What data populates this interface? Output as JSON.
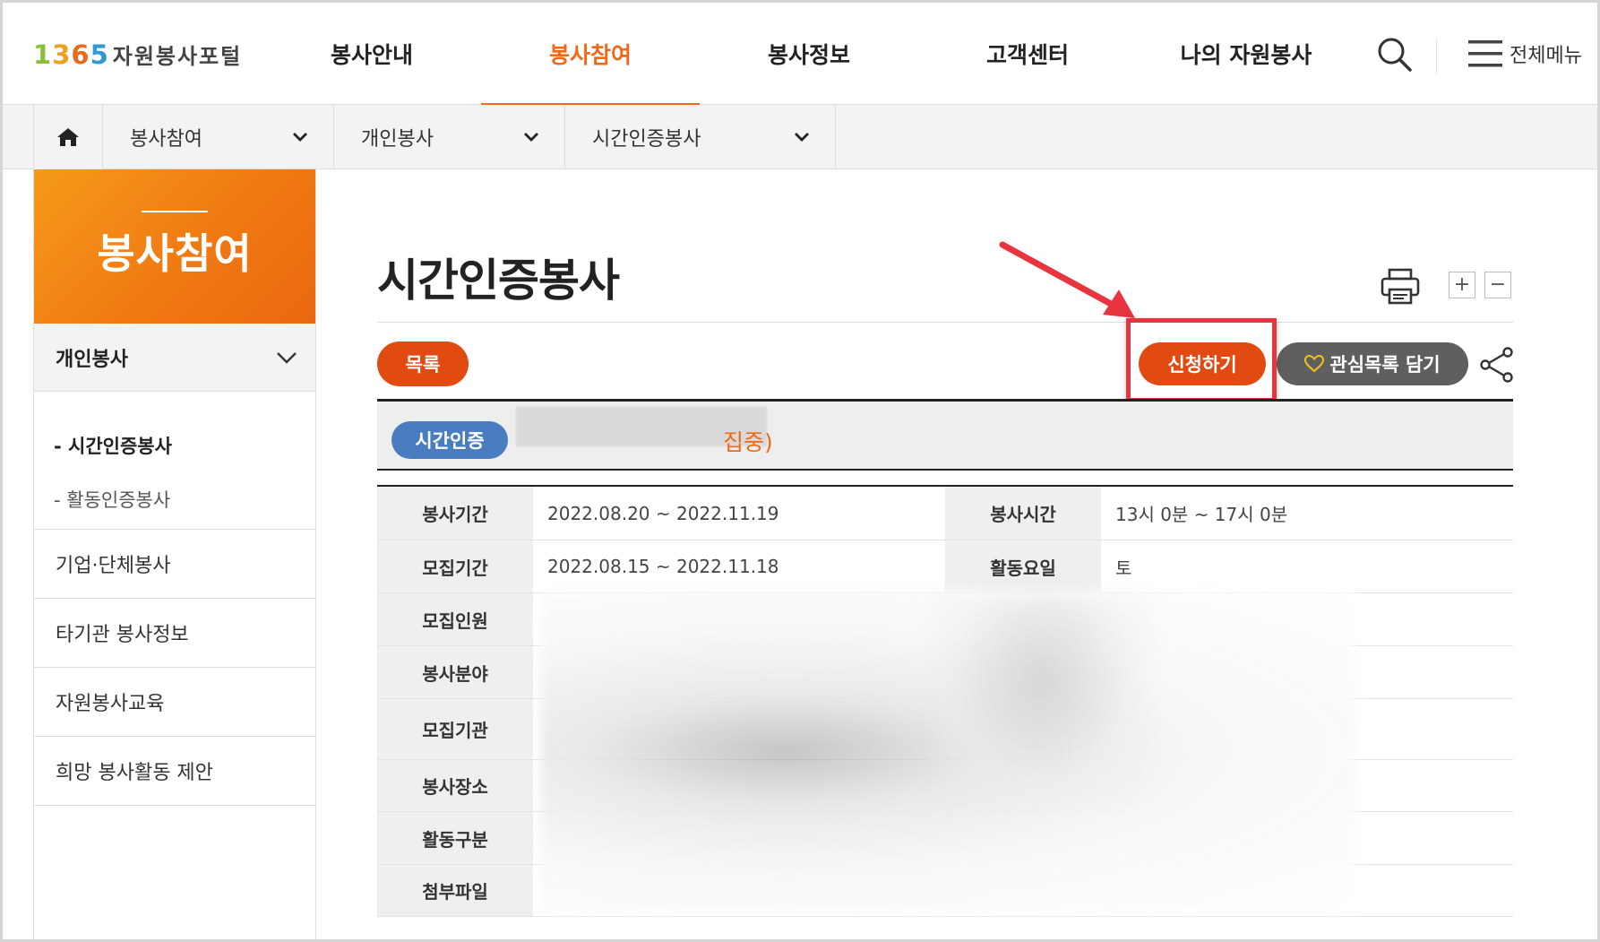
{
  "header": {
    "logo_num": [
      "1",
      "3",
      "6",
      "5"
    ],
    "logo_text": "자원봉사포털",
    "nav": [
      "봉사안내",
      "봉사참여",
      "봉사정보",
      "고객센터",
      "나의 자원봉사"
    ],
    "active_nav_index": 1,
    "search_icon": "search-icon",
    "all_menu_label": "전체메뉴"
  },
  "location": {
    "home_icon": "home-icon",
    "items": [
      "봉사참여",
      "개인봉사",
      "시간인증봉사"
    ]
  },
  "sidebar": {
    "title": "봉사참여",
    "sub_title": "개인봉사",
    "depth3": [
      "- 시간인증봉사",
      "- 활동인증봉사"
    ],
    "menus": [
      "기업·단체봉사",
      "타기관 봉사정보",
      "자원봉사교육",
      "희망 봉사활동 제안"
    ]
  },
  "content": {
    "page_title": "시간인증봉사",
    "list_btn": "목록",
    "apply_btn": "신청하기",
    "fav_btn": "관심목록 담기",
    "badge": "시간인증",
    "status": "집중)",
    "zoom_in": "+",
    "zoom_out": "−"
  },
  "info": {
    "row1": {
      "h1": "봉사기간",
      "v1": "2022.08.20 ~ 2022.11.19",
      "h2": "봉사시간",
      "v2": "13시 0분 ~ 17시 0분"
    },
    "row2": {
      "h1": "모집기간",
      "v1": "2022.08.15 ~ 2022.11.18",
      "h2": "활동요일",
      "v2": "토"
    },
    "rows": [
      "모집인원",
      "봉사분야",
      "모집기관",
      "봉사장소",
      "활동구분",
      "첨부파일"
    ]
  },
  "colors": {
    "accent": "#ee6a1a",
    "button": "#e14a10",
    "badge": "#4a7dbf",
    "highlight": "#e8343f"
  }
}
